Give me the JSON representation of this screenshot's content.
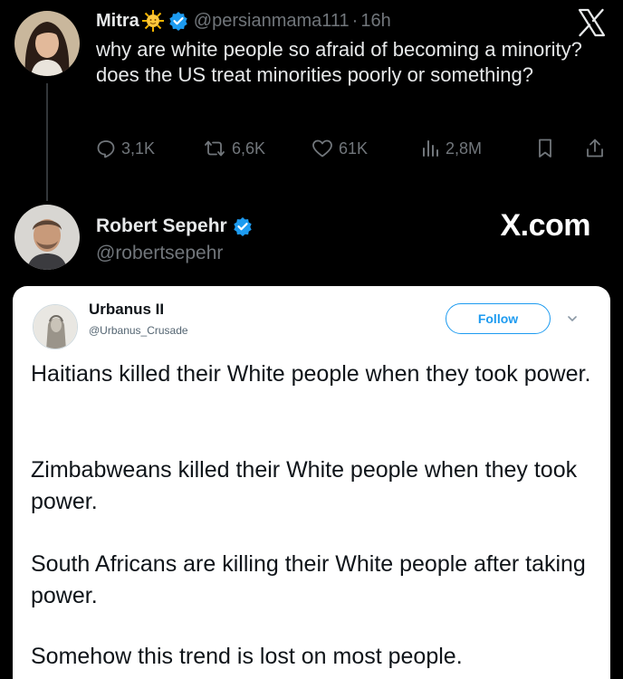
{
  "tweet": {
    "author_name": "Mitra",
    "handle": "@persianmama111",
    "separator": "·",
    "time": "16h",
    "text": "why are white people so afraid of becoming a minority? does the US treat minorities poorly or something?",
    "replies": "3,1K",
    "reposts": "6,6K",
    "likes": "61K",
    "views": "2,8M"
  },
  "reply_author": {
    "name": "Robert Sepehr",
    "handle": "@robertsepehr",
    "watermark": "X.com"
  },
  "embedded": {
    "name": "Urbanus II",
    "handle": "@Urbanus_Crusade",
    "follow_label": "Follow",
    "paragraphs": [
      "Haitians killed their White people when they took power.",
      "Zimbabweans killed their White people when they took power.",
      "South Africans are killing their White people after taking power.",
      "Somehow this trend is lost on most people."
    ]
  },
  "icons": {
    "verified": "verified-badge-icon",
    "emoji": "sun-emoji-icon",
    "logo": "x-logo-icon",
    "reply": "reply-icon",
    "repost": "repost-icon",
    "like": "heart-icon",
    "views": "views-icon",
    "bookmark": "bookmark-icon",
    "share": "share-icon"
  },
  "colors": {
    "background": "#000000",
    "text_primary": "#e7e9ea",
    "text_secondary": "#71767b",
    "verified": "#1d9bf0",
    "card_background": "#ffffff"
  }
}
